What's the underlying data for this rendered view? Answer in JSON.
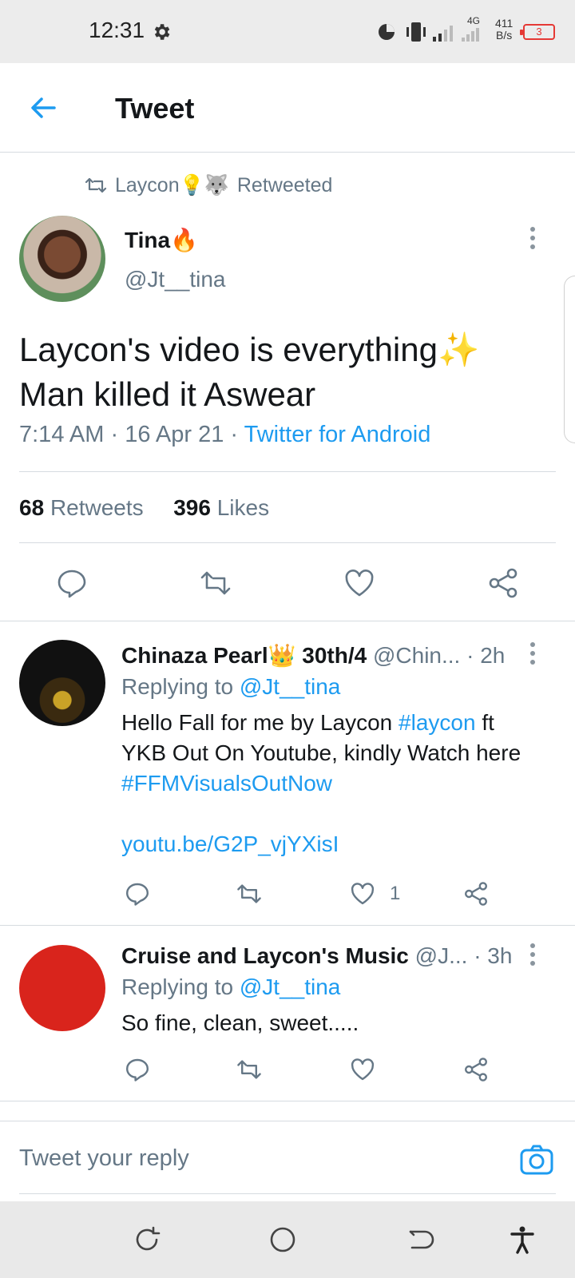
{
  "status_bar": {
    "time": "12:31",
    "network": "4G",
    "speed_value": "411",
    "speed_unit": "B/s",
    "battery": "3"
  },
  "header": {
    "title": "Tweet"
  },
  "retweet_context": {
    "user": "Laycon💡🐺",
    "label": "Retweeted"
  },
  "tweet": {
    "author_name": "Tina🔥",
    "author_handle": "@Jt__tina",
    "text_line1": "Laycon's video is everything✨",
    "text_line2": "Man killed it Aswear",
    "time": "7:14 AM",
    "date": "16 Apr 21",
    "source": "Twitter for Android",
    "retweets_count": "68",
    "retweets_label": "Retweets",
    "likes_count": "396",
    "likes_label": "Likes"
  },
  "replies": [
    {
      "name": "Chinaza Pearl👑 30th/4",
      "handle": "@Chin...",
      "time": "· 2h",
      "replying_label": "Replying to",
      "replying_to": "@Jt__tina",
      "body_part1": "Hello Fall for me by Laycon ",
      "hashtag1": "#laycon",
      "body_part2": " ft YKB Out On Youtube, kindly Watch here",
      "hashtag2": "#FFMVisualsOutNow",
      "link": "youtu.be/G2P_vjYXisI",
      "like_count": "1"
    },
    {
      "name": "Cruise and Laycon's Music",
      "handle": "@J...",
      "time": "· 3h",
      "replying_label": "Replying to",
      "replying_to": "@Jt__tina",
      "body": "So fine, clean, sweet....."
    }
  ],
  "reply_box": {
    "placeholder": "Tweet your reply"
  },
  "colors": {
    "accent": "#1d9bf0",
    "muted": "#657786",
    "text": "#14171a"
  },
  "icons": [
    "gear-icon",
    "back-arrow-icon",
    "retweet-icon",
    "reply-icon",
    "like-icon",
    "share-icon",
    "more-icon",
    "camera-icon"
  ]
}
